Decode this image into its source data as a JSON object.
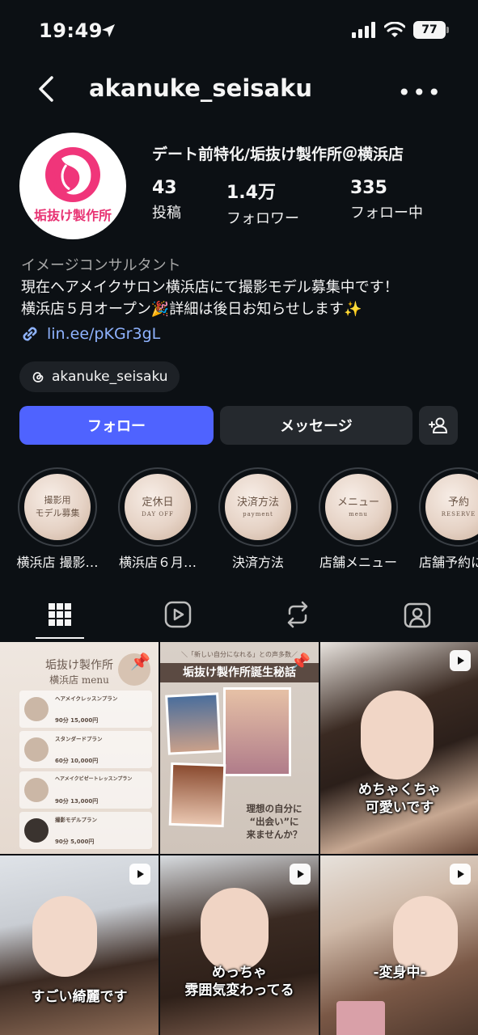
{
  "status": {
    "time": "19:49",
    "battery": "77"
  },
  "header": {
    "username": "akanuke_seisaku"
  },
  "profile": {
    "avatar_text": "垢抜け製作所",
    "display_name": "デート前特化/垢抜け製作所＠横浜店",
    "stats": [
      {
        "value": "43",
        "label": "投稿"
      },
      {
        "value": "1.4万",
        "label": "フォロワー"
      },
      {
        "value": "335",
        "label": "フォロー中"
      }
    ],
    "category": "イメージコンサルタント",
    "bio_line1": "現在ヘアメイクサロン横浜店にて撮影モデル募集中です！",
    "bio_line2": "横浜店５月オープン🎉詳細は後日お知らせします✨",
    "link": "lin.ee/pKGr3gL",
    "threads": "akanuke_seisaku"
  },
  "buttons": {
    "follow": "フォロー",
    "message": "メッセージ"
  },
  "highlights": [
    {
      "cover": "撮影用\nモデル募集",
      "sub": "",
      "name": "横浜店 撮影…"
    },
    {
      "cover": "定休日",
      "sub": "DAY OFF",
      "name": "横浜店６月…"
    },
    {
      "cover": "決済方法",
      "sub": "payment",
      "name": "決済方法"
    },
    {
      "cover": "メニュー",
      "sub": "menu",
      "name": "店舗メニュー"
    },
    {
      "cover": "予約",
      "sub": "RESERVE",
      "name": "店舗予約に"
    }
  ],
  "posts": [
    {
      "type": "pinned-image",
      "title": "垢抜け製作所",
      "subtitle": "横浜店 menu",
      "items": [
        {
          "name": "ヘアメイクレッスンプラン",
          "price": "90分 15,000円"
        },
        {
          "name": "スタンダードプラン",
          "price": "60分 10,000円"
        },
        {
          "name": "ヘアメイクビゼートレッスンプラン",
          "price": "90分 13,000円"
        },
        {
          "name": "撮影モデルプラン",
          "price": "90分 5,000円"
        }
      ]
    },
    {
      "type": "pinned-image",
      "top": "＼「新しい自分になれる」との声多数／",
      "title": "垢抜け製作所誕生秘話",
      "lines": [
        "理想の自分に",
        "“出会い”に",
        "来ませんか？"
      ]
    },
    {
      "type": "reel",
      "caption": "めちゃくちゃ\n可愛いです"
    },
    {
      "type": "reel",
      "caption": "すごい綺麗です"
    },
    {
      "type": "reel",
      "caption": "めっちゃ\n雰囲気変わってる"
    },
    {
      "type": "reel",
      "caption": "-変身中-"
    }
  ]
}
